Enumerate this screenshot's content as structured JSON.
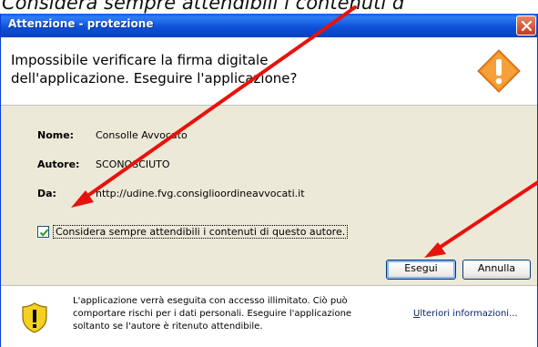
{
  "caption": "Considera sempre attendibili i contenuti d",
  "dialog": {
    "title": "Attenzione - protezione",
    "heading_line1": "Impossibile verificare la firma digitale",
    "heading_line2": "dell'applicazione.  Eseguire l'applicazione?",
    "fields": [
      {
        "label": "Nome:",
        "value": "Consolle Avvocato"
      },
      {
        "label": "Autore:",
        "value": "SCONOSCIUTO"
      },
      {
        "label": "Da:",
        "value": "http://udine.fvg.consiglioordineavvocati.it"
      }
    ],
    "checkbox": {
      "label": "Considera sempre attendibili i contenuti di questo autore.",
      "checked": true
    },
    "buttons": {
      "run": "Esegui",
      "cancel": "Annulla"
    },
    "footer": {
      "line1": "L'applicazione verrà eseguita con accesso illimitato. Ciò può",
      "line2": "comportare rischi per i dati personali. Eseguire l'applicazione",
      "line3": "soltanto se l'autore è ritenuto attendibile.",
      "more_info_first": "U",
      "more_info_rest": "lteriori informazioni..."
    }
  },
  "colors": {
    "annotation": "#e8120c",
    "titlebar": "#0c4fd6",
    "warning": "#f08a1a"
  },
  "icons": [
    "close-icon",
    "warning-icon",
    "checkmark-icon",
    "shield-warning-icon"
  ]
}
